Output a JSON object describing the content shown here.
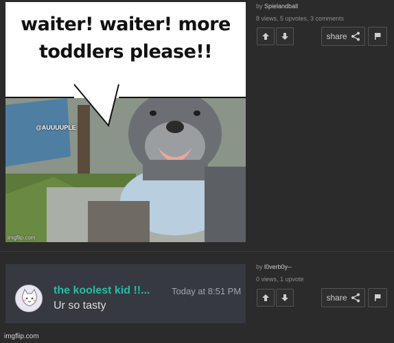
{
  "posts": [
    {
      "caption": [
        "waiter! waiter! more",
        "toddlers please!!"
      ],
      "tag": "@AUUUUPLE",
      "image_watermark": "imgflip.com",
      "author_prefix": "by",
      "author": "Spielandball",
      "stats": "8 views, 5 upvotes, 3 comments",
      "share_label": "share"
    },
    {
      "chat": {
        "name": "the koolest kid !!...",
        "time": "Today at 8:51 PM",
        "message": "Ur so tasty"
      },
      "image_watermark": "imgflip.com",
      "author_prefix": "by",
      "author": "l0verb0y--",
      "stats": "0 views, 1 upvote",
      "share_label": "share"
    }
  ]
}
